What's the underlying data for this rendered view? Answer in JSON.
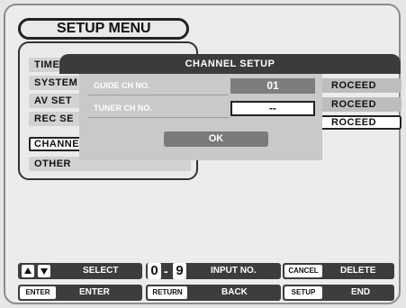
{
  "header": {
    "title": "SETUP MENU"
  },
  "menu": {
    "items": [
      {
        "label": "TIMER"
      },
      {
        "label": "SYSTEM"
      },
      {
        "label": "AV SET"
      },
      {
        "label": "REC SE"
      },
      {
        "label": "CHANNE",
        "selected": true
      },
      {
        "label": "OTHER"
      }
    ]
  },
  "side": {
    "proceed": [
      "ROCEED",
      "ROCEED",
      "ROCEED"
    ]
  },
  "dialog": {
    "title": "CHANNEL SETUP",
    "guide_label": "GUIDE CH NO.",
    "guide_value": "01",
    "tuner_label": "TUNER CH NO.",
    "tuner_value": "--",
    "ok_label": "OK"
  },
  "footer": {
    "select_label": "SELECT",
    "digits_from": "0",
    "digits_sep": "-",
    "digits_to": "9",
    "input_label": "INPUT NO.",
    "cancel_key": "CANCEL",
    "delete_label": "DELETE",
    "enter_key": "ENTER",
    "enter_label": "ENTER",
    "return_key": "RETURN",
    "back_label": "BACK",
    "setup_key": "SETUP",
    "end_label": "END"
  },
  "colors": {
    "header_bar": "#3b3b3b",
    "button_bar": "#3d3d3d",
    "panel": "#ececec"
  }
}
